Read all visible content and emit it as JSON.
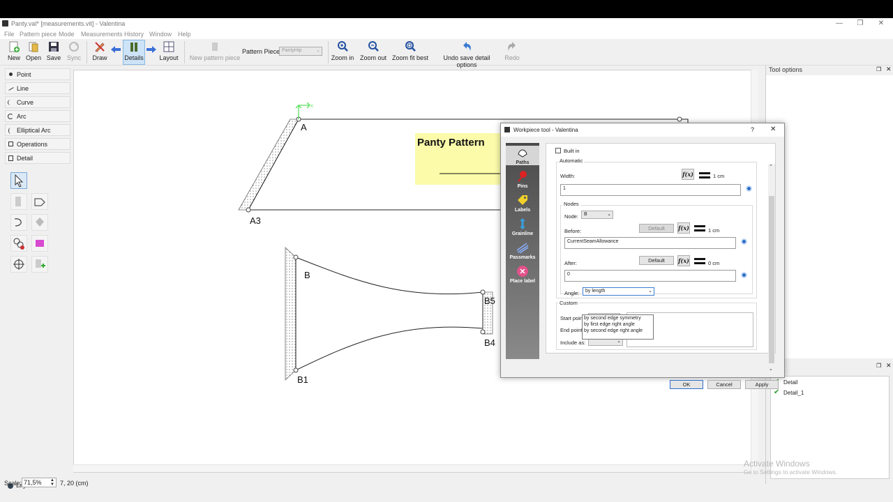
{
  "window": {
    "title": "Panty.val* [measurements.vit] - Valentina"
  },
  "menu": [
    "File",
    "Pattern piece",
    "Mode",
    "Measurements",
    "History",
    "Window",
    "Help"
  ],
  "toolbar": {
    "new": "New",
    "open": "Open",
    "save": "Save",
    "sync": "Sync",
    "draw": "Draw",
    "details": "Details",
    "layout": "Layout",
    "new_piece": "New pattern piece",
    "pattern_piece_label": "Pattern Piece:",
    "pattern_piece_value": "PantyHip",
    "zoom_in": "Zoom in",
    "zoom_out": "Zoom out",
    "zoom_fit": "Zoom fit best",
    "undo": "Undo save detail options",
    "redo": "Redo"
  },
  "tool_categories": [
    "Point",
    "Line",
    "Curve",
    "Arc",
    "Elliptical Arc",
    "Operations",
    "Detail"
  ],
  "left_bottom": "Layout",
  "canvas": {
    "points": {
      "A": "A",
      "A3": "A3",
      "B": "B",
      "B5": "B5",
      "B4": "B4",
      "B1": "B1"
    },
    "label_box": "Panty Pattern",
    "axis_y": "Y",
    "axis_x": "X"
  },
  "status": {
    "scale_label": "Scale:",
    "scale_value": "71,5%",
    "coords": "7, 20 (cm)"
  },
  "tool_options": {
    "title": "Tool options"
  },
  "details_list": {
    "items": [
      "Detail",
      "Detail_1"
    ]
  },
  "watermark": {
    "line1": "Activate Windows",
    "line2": "Go to Settings to activate Windows."
  },
  "dialog": {
    "title": "Workpiece tool - Valentina",
    "help": "?",
    "close": "✕",
    "sidebar": [
      "Paths",
      "Pins",
      "Labels",
      "Grainline",
      "Passmarks",
      "Place label"
    ],
    "built_in": "Built in",
    "automatic": "Automatic",
    "width_label": "Width:",
    "width_value": "1 cm",
    "width_field": "1",
    "nodes": "Nodes",
    "node_label": "Node:",
    "node_value": "B",
    "before_label": "Before:",
    "before_default": "Default",
    "before_value": "1 cm",
    "before_field": "CurrentSeamAllowance",
    "after_label": "After:",
    "after_default": "Default",
    "after_value": "0 cm",
    "after_field": "0",
    "angle_label": "Angle:",
    "angle_value": "by length",
    "angle_options": [
      "by second edge symmetry",
      "by first edge right angle",
      "by second edge right angle"
    ],
    "custom": "Custom",
    "start_point": "Start point:",
    "end_point": "End point:",
    "include_as": "Include as:",
    "fx": "f(x)",
    "ok": "OK",
    "cancel": "Cancel",
    "apply": "Apply"
  }
}
